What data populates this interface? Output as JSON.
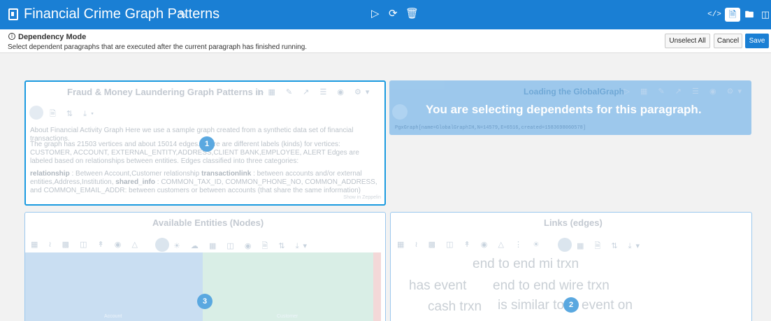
{
  "header": {
    "title": "Financial Crime Graph Patterns",
    "center_icons": [
      "play-icon",
      "refresh-icon",
      "trash-icon"
    ],
    "right_icons": [
      "code-icon",
      "report-icon",
      "folder-icon",
      "split-view-icon"
    ]
  },
  "dependency": {
    "mode_label": "Dependency Mode",
    "description": "Select dependent paragraphs that are executed after the current paragraph has finished running.",
    "unselect_label": "Unselect All",
    "cancel_label": "Cancel",
    "save_label": "Save"
  },
  "paragraphs": {
    "fraud": {
      "title": "Fraud & Money Laundering Graph Patterns in",
      "line1": "About Financial Activity Graph Here we use a sample graph created from a synthetic data set of financial transactions.",
      "line2": "The graph has 21503 vertices and about 15014 edges. There are different labels (kinds) for vertices: CUSTOMER, ACCOUNT, EXTERNAL_ENTITY,ADDRESS,CLIENT BANK,EMPLOYEE, ALERT Edges are labeled based on relationships between entities. Edges classified into three categories:",
      "rel_label": "relationship",
      "rel_text": ": Between Account,Customer relationship",
      "txn_label": "transactionlink",
      "txn_text": ": between accounts and/or external entities,Address,Institution,",
      "shared_label": "shared_info",
      "shared_text": ": COMMON_TAX_ID, COMMON_PHONE_NO, COMMON_ADDRESS, and COMMON_EMAIL_ADDR: between customers or between accounts (that share the same information)",
      "footer": "Show in Zeppelin",
      "badge": "1"
    },
    "loading": {
      "title": "Loading the GlobalGraph",
      "overlay_message": "You are selecting dependents for this paragraph.",
      "data": "PgxGraph[name=GlobalGraphIH,N=14579,E=6516,created=1583698060578]"
    },
    "entities": {
      "title": "Available Entities (Nodes)",
      "bar1_label": "Account",
      "bar2_label": "Customer",
      "badge": "3"
    },
    "links": {
      "title": "Links (edges)",
      "words": [
        "end to end mi trxn",
        "has event",
        "end to end wire trxn",
        "cash trxn",
        "is similar to",
        "event on"
      ],
      "badge": "2"
    }
  }
}
